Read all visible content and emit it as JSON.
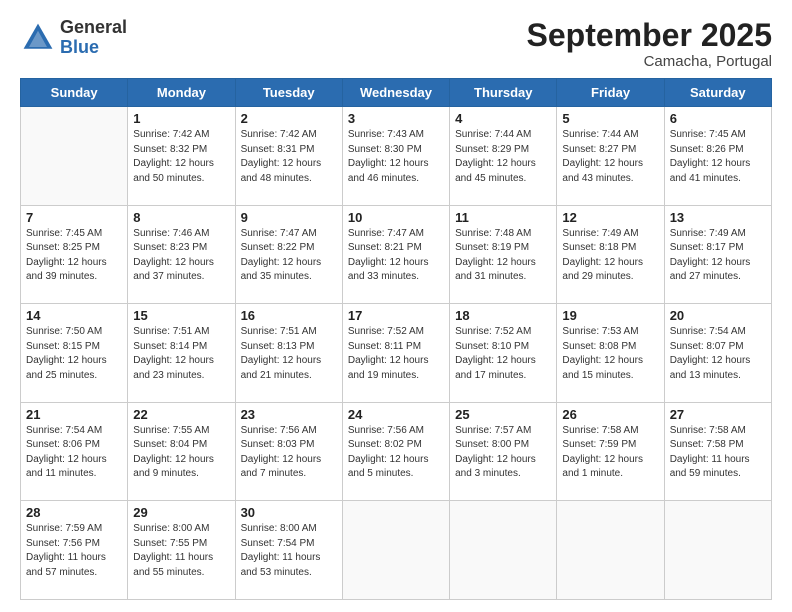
{
  "header": {
    "logo_general": "General",
    "logo_blue": "Blue",
    "title": "September 2025",
    "subtitle": "Camacha, Portugal"
  },
  "days_of_week": [
    "Sunday",
    "Monday",
    "Tuesday",
    "Wednesday",
    "Thursday",
    "Friday",
    "Saturday"
  ],
  "weeks": [
    [
      {
        "day": "",
        "info": ""
      },
      {
        "day": "1",
        "info": "Sunrise: 7:42 AM\nSunset: 8:32 PM\nDaylight: 12 hours\nand 50 minutes."
      },
      {
        "day": "2",
        "info": "Sunrise: 7:42 AM\nSunset: 8:31 PM\nDaylight: 12 hours\nand 48 minutes."
      },
      {
        "day": "3",
        "info": "Sunrise: 7:43 AM\nSunset: 8:30 PM\nDaylight: 12 hours\nand 46 minutes."
      },
      {
        "day": "4",
        "info": "Sunrise: 7:44 AM\nSunset: 8:29 PM\nDaylight: 12 hours\nand 45 minutes."
      },
      {
        "day": "5",
        "info": "Sunrise: 7:44 AM\nSunset: 8:27 PM\nDaylight: 12 hours\nand 43 minutes."
      },
      {
        "day": "6",
        "info": "Sunrise: 7:45 AM\nSunset: 8:26 PM\nDaylight: 12 hours\nand 41 minutes."
      }
    ],
    [
      {
        "day": "7",
        "info": "Sunrise: 7:45 AM\nSunset: 8:25 PM\nDaylight: 12 hours\nand 39 minutes."
      },
      {
        "day": "8",
        "info": "Sunrise: 7:46 AM\nSunset: 8:23 PM\nDaylight: 12 hours\nand 37 minutes."
      },
      {
        "day": "9",
        "info": "Sunrise: 7:47 AM\nSunset: 8:22 PM\nDaylight: 12 hours\nand 35 minutes."
      },
      {
        "day": "10",
        "info": "Sunrise: 7:47 AM\nSunset: 8:21 PM\nDaylight: 12 hours\nand 33 minutes."
      },
      {
        "day": "11",
        "info": "Sunrise: 7:48 AM\nSunset: 8:19 PM\nDaylight: 12 hours\nand 31 minutes."
      },
      {
        "day": "12",
        "info": "Sunrise: 7:49 AM\nSunset: 8:18 PM\nDaylight: 12 hours\nand 29 minutes."
      },
      {
        "day": "13",
        "info": "Sunrise: 7:49 AM\nSunset: 8:17 PM\nDaylight: 12 hours\nand 27 minutes."
      }
    ],
    [
      {
        "day": "14",
        "info": "Sunrise: 7:50 AM\nSunset: 8:15 PM\nDaylight: 12 hours\nand 25 minutes."
      },
      {
        "day": "15",
        "info": "Sunrise: 7:51 AM\nSunset: 8:14 PM\nDaylight: 12 hours\nand 23 minutes."
      },
      {
        "day": "16",
        "info": "Sunrise: 7:51 AM\nSunset: 8:13 PM\nDaylight: 12 hours\nand 21 minutes."
      },
      {
        "day": "17",
        "info": "Sunrise: 7:52 AM\nSunset: 8:11 PM\nDaylight: 12 hours\nand 19 minutes."
      },
      {
        "day": "18",
        "info": "Sunrise: 7:52 AM\nSunset: 8:10 PM\nDaylight: 12 hours\nand 17 minutes."
      },
      {
        "day": "19",
        "info": "Sunrise: 7:53 AM\nSunset: 8:08 PM\nDaylight: 12 hours\nand 15 minutes."
      },
      {
        "day": "20",
        "info": "Sunrise: 7:54 AM\nSunset: 8:07 PM\nDaylight: 12 hours\nand 13 minutes."
      }
    ],
    [
      {
        "day": "21",
        "info": "Sunrise: 7:54 AM\nSunset: 8:06 PM\nDaylight: 12 hours\nand 11 minutes."
      },
      {
        "day": "22",
        "info": "Sunrise: 7:55 AM\nSunset: 8:04 PM\nDaylight: 12 hours\nand 9 minutes."
      },
      {
        "day": "23",
        "info": "Sunrise: 7:56 AM\nSunset: 8:03 PM\nDaylight: 12 hours\nand 7 minutes."
      },
      {
        "day": "24",
        "info": "Sunrise: 7:56 AM\nSunset: 8:02 PM\nDaylight: 12 hours\nand 5 minutes."
      },
      {
        "day": "25",
        "info": "Sunrise: 7:57 AM\nSunset: 8:00 PM\nDaylight: 12 hours\nand 3 minutes."
      },
      {
        "day": "26",
        "info": "Sunrise: 7:58 AM\nSunset: 7:59 PM\nDaylight: 12 hours\nand 1 minute."
      },
      {
        "day": "27",
        "info": "Sunrise: 7:58 AM\nSunset: 7:58 PM\nDaylight: 11 hours\nand 59 minutes."
      }
    ],
    [
      {
        "day": "28",
        "info": "Sunrise: 7:59 AM\nSunset: 7:56 PM\nDaylight: 11 hours\nand 57 minutes."
      },
      {
        "day": "29",
        "info": "Sunrise: 8:00 AM\nSunset: 7:55 PM\nDaylight: 11 hours\nand 55 minutes."
      },
      {
        "day": "30",
        "info": "Sunrise: 8:00 AM\nSunset: 7:54 PM\nDaylight: 11 hours\nand 53 minutes."
      },
      {
        "day": "",
        "info": ""
      },
      {
        "day": "",
        "info": ""
      },
      {
        "day": "",
        "info": ""
      },
      {
        "day": "",
        "info": ""
      }
    ]
  ]
}
